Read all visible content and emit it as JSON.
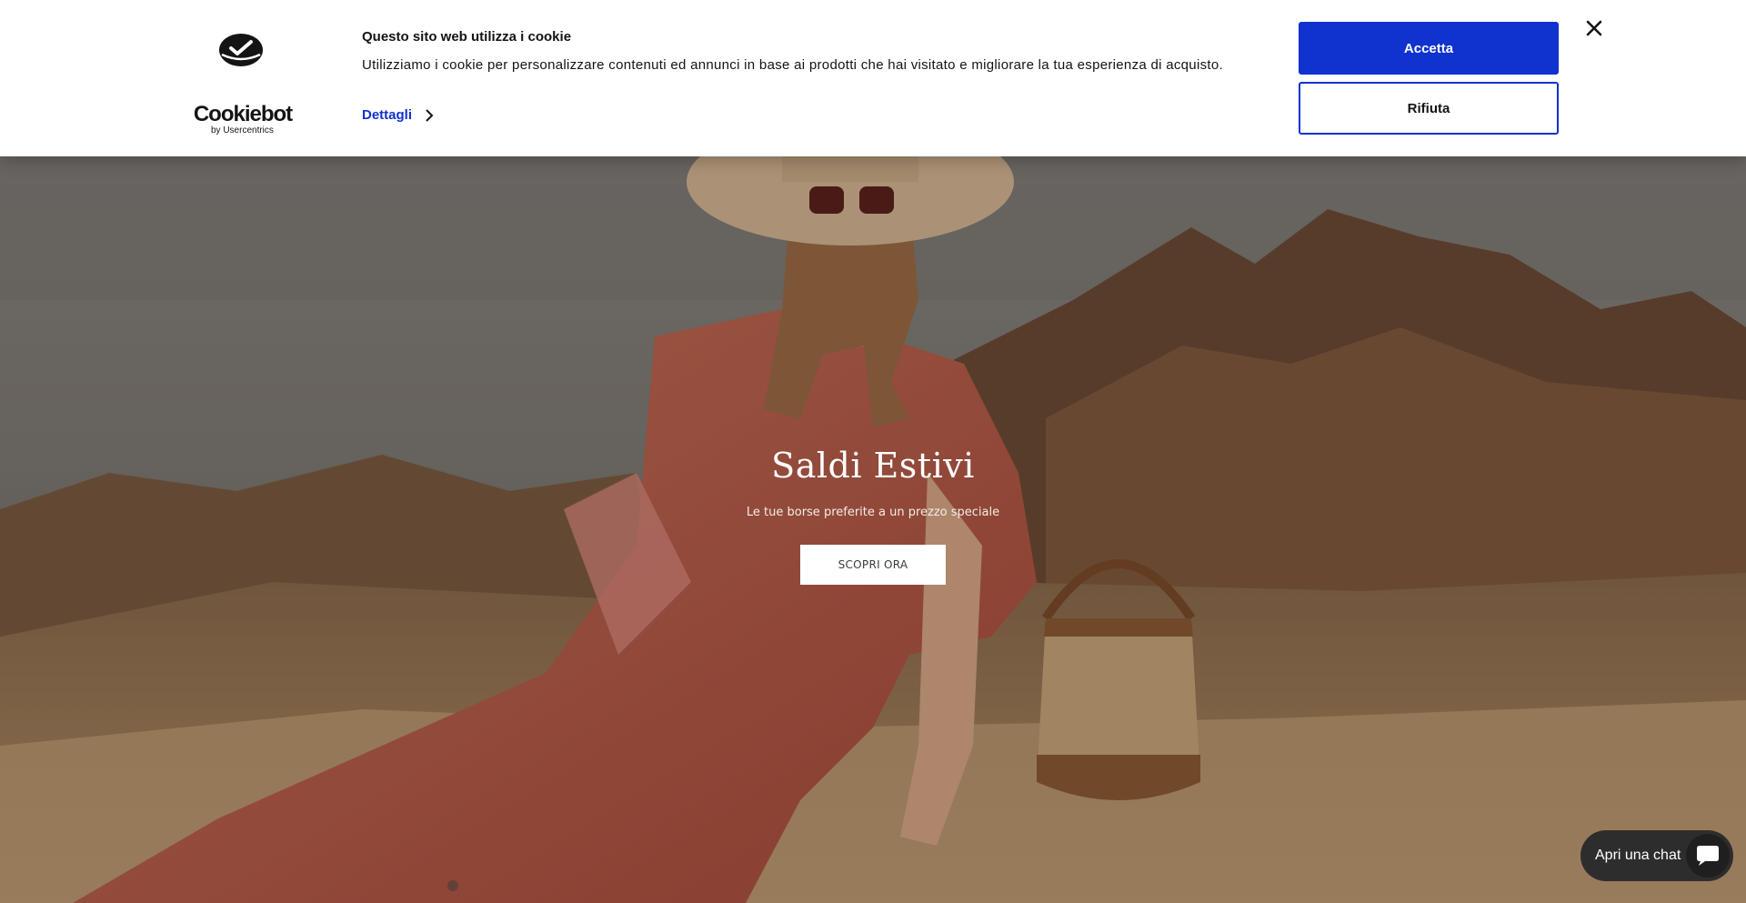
{
  "cookie_banner": {
    "title": "Questo sito web utilizza i cookie",
    "text": "Utilizziamo i cookie per personalizzare contenuti ed annunci in base ai prodotti che hai visitato e migliorare la tua esperienza di acquisto.",
    "details_label": "Dettagli",
    "accept_label": "Accetta",
    "reject_label": "Rifiuta",
    "brand_name": "Cookiebot",
    "brand_by": "by Usercentrics",
    "accent_color": "#1032cf"
  },
  "hero": {
    "title": "Saldi Estivi",
    "subtitle": "Le tue borse preferite a un prezzo speciale",
    "cta_label": "SCOPRI ORA"
  },
  "chat": {
    "label": "Apri una chat",
    "icon": "chat-bubble-icon"
  }
}
